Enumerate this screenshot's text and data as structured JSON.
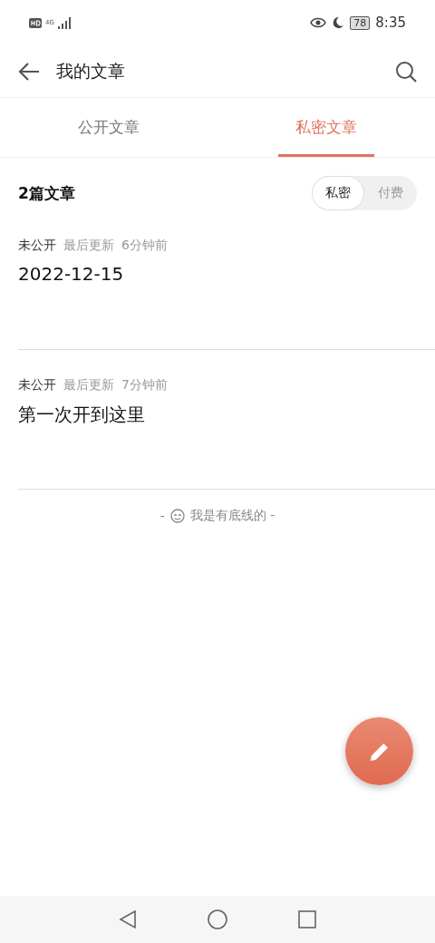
{
  "status_bar": {
    "network": "4G",
    "battery": "78",
    "time": "8:35"
  },
  "header": {
    "title": "我的文章"
  },
  "tabs": [
    {
      "label": "公开文章",
      "selected": false
    },
    {
      "label": "私密文章",
      "selected": true
    }
  ],
  "list_header": {
    "count": "2篇文章",
    "filters": [
      {
        "label": "私密",
        "selected": true
      },
      {
        "label": "付费",
        "selected": false
      }
    ]
  },
  "articles": [
    {
      "status": "未公开",
      "updated_label": "最后更新",
      "time": "6分钟前",
      "title": "2022-12-15"
    },
    {
      "status": "未公开",
      "updated_label": "最后更新",
      "time": "7分钟前",
      "title": "第一次开到这里"
    }
  ],
  "footer": {
    "left": "-",
    "text": "我是有底线的 -"
  }
}
